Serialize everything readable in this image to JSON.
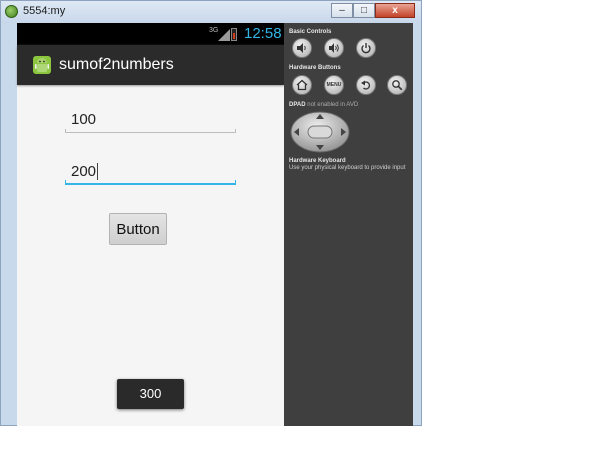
{
  "window": {
    "title": "5554:my",
    "minimize_label": "–",
    "maximize_label": "□",
    "close_label": "x"
  },
  "status_bar": {
    "network": "3G",
    "time": "12:58",
    "clock_color": "#33b5e5"
  },
  "app": {
    "title": "sumof2numbers",
    "first_number": "100",
    "second_number": "200",
    "button_label": "Button",
    "toast_text": "300"
  },
  "controls": {
    "basic_controls_label": "Basic Controls",
    "hardware_buttons_label": "Hardware Buttons",
    "menu_label": "MENU",
    "dpad_label": "DPAD",
    "dpad_note": "not enabled in AVD",
    "keyboard_label": "Hardware Keyboard",
    "keyboard_hint": "Use your physical keyboard to provide input",
    "icons": [
      "volume-down-icon",
      "volume-up-icon",
      "power-icon",
      "home-icon",
      "menu-icon",
      "back-icon",
      "search-icon"
    ]
  }
}
